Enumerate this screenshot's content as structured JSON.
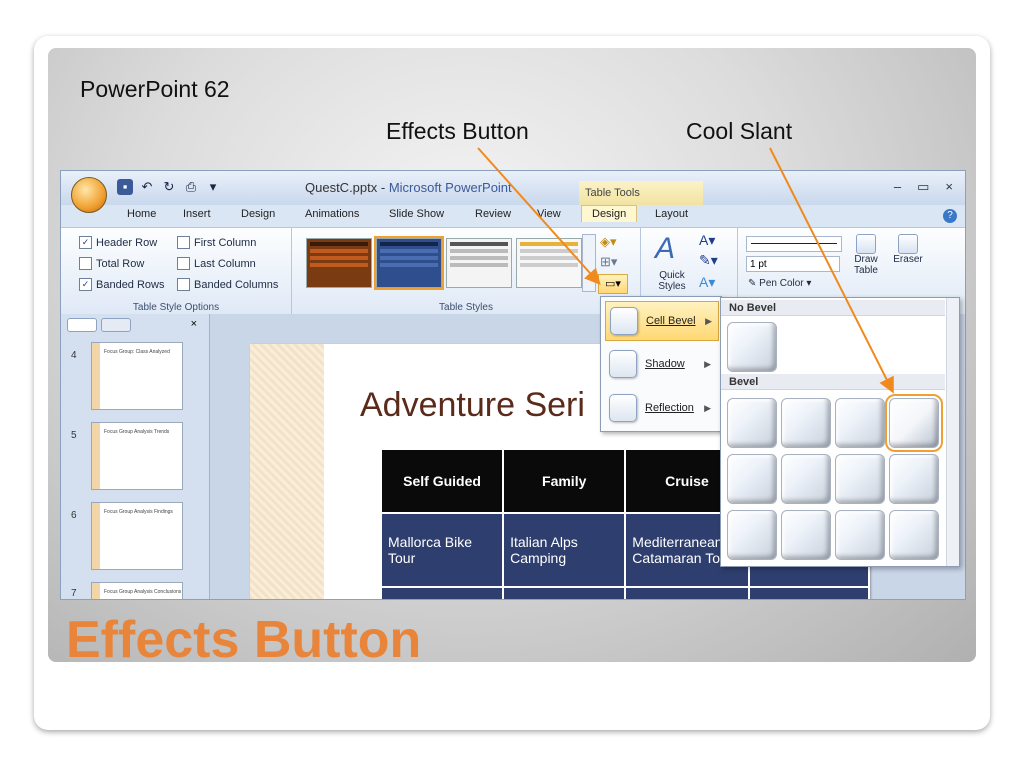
{
  "slide_label": "PowerPoint 62",
  "callouts": {
    "effects": "Effects Button",
    "cool_slant": "Cool Slant"
  },
  "big_title": "Effects Button",
  "window": {
    "file": "QuestC.pptx",
    "separator": " - ",
    "app": "Microsoft PowerPoint",
    "context_tab": "Table Tools",
    "controls": {
      "minimize": "–",
      "maximize": "▭",
      "close": "×"
    }
  },
  "tabs": [
    "Home",
    "Insert",
    "Design",
    "Animations",
    "Slide Show",
    "Review",
    "View",
    "Design",
    "Layout"
  ],
  "ribbon": {
    "options": [
      "Header Row",
      "First Column",
      "Total Row",
      "Last Column",
      "Banded Rows",
      "Banded Columns"
    ],
    "options_checked": [
      true,
      false,
      false,
      false,
      true,
      false
    ],
    "group_style_options": "Table Style Options",
    "group_table_styles": "Table Styles",
    "quick_styles": "Quick Styles",
    "pen_weight": "1 pt",
    "pen_color": "Pen Color",
    "draw_table": "Draw Table",
    "eraser": "Eraser"
  },
  "thumbnails": [
    {
      "num": "4",
      "title": "Focus Group: Class Analyzed"
    },
    {
      "num": "5",
      "title": "Focus Group Analysis Trends"
    },
    {
      "num": "6",
      "title": "Focus Group Analysis Findings"
    },
    {
      "num": "7",
      "title": "Focus Group Analysis Conclusions"
    }
  ],
  "slide": {
    "title": "Adventure Seri",
    "headers": [
      "Self Guided",
      "Family",
      "Cruise"
    ],
    "row1": [
      "Mallorca Bike Tour",
      "Italian Alps Camping",
      "Mediterranean Catamaran Tour"
    ]
  },
  "effects_menu": {
    "cell_bevel": "Cell Bevel",
    "shadow": "Shadow",
    "reflection": "Reflection"
  },
  "bevel_gallery": {
    "no_bevel": "No Bevel",
    "bevel": "Bevel",
    "selected": "Cool Slant"
  },
  "colors": {
    "accent": "#e8853a",
    "arrow": "#f08a1e",
    "table_header": "#0a0a0a",
    "table_row": "#2e3f6f"
  }
}
